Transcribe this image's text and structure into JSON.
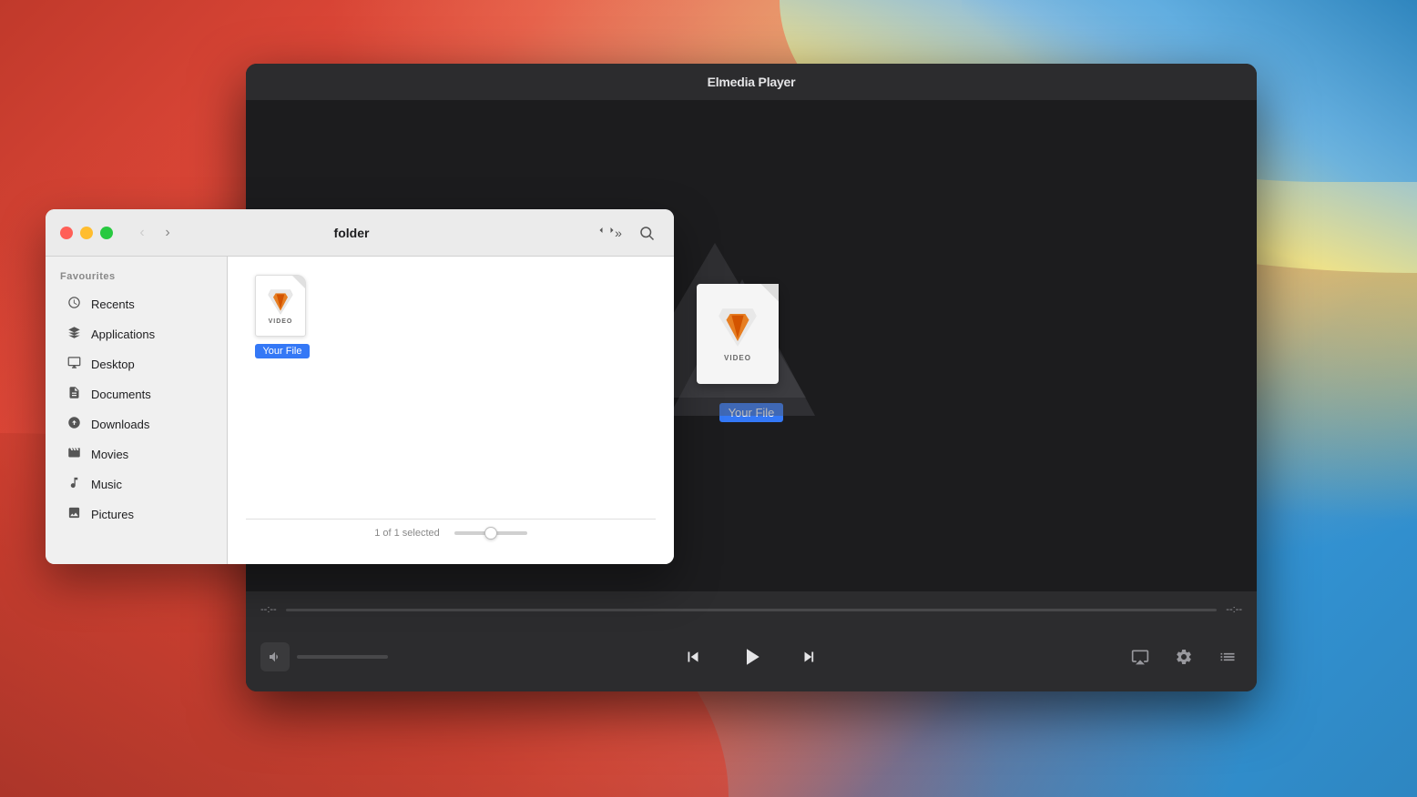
{
  "wallpaper": {
    "colors": {
      "redBase": "#c0392b",
      "blueAccent": "#3498db",
      "orangeAccent": "#e8a87c"
    }
  },
  "playerWindow": {
    "title": "Elmedia Player",
    "fileIcon": {
      "label": "VIDEO",
      "filename": "Your File"
    },
    "controls": {
      "timeStart": "--:--",
      "timeEnd": "--:--",
      "volumeButton": "🔈",
      "prevLabel": "⏮",
      "playLabel": "▶",
      "nextLabel": "⏭",
      "airplayLabel": "⊹",
      "settingsLabel": "⚙",
      "listLabel": "≡"
    }
  },
  "finderWindow": {
    "title": "folder",
    "sidebar": {
      "sectionLabel": "Favourites",
      "items": [
        {
          "id": "recents",
          "icon": "🕐",
          "label": "Recents"
        },
        {
          "id": "applications",
          "icon": "✦",
          "label": "Applications"
        },
        {
          "id": "desktop",
          "icon": "🖥",
          "label": "Desktop"
        },
        {
          "id": "documents",
          "icon": "📄",
          "label": "Documents"
        },
        {
          "id": "downloads",
          "icon": "⊙",
          "label": "Downloads"
        },
        {
          "id": "movies",
          "icon": "🎞",
          "label": "Movies"
        },
        {
          "id": "music",
          "icon": "♪",
          "label": "Music"
        },
        {
          "id": "pictures",
          "icon": "🖼",
          "label": "Pictures"
        }
      ]
    },
    "content": {
      "file": {
        "iconLabel": "VIDEO",
        "filename": "Your File"
      }
    },
    "statusbar": {
      "selectedText": "1 of 1 selected"
    },
    "toolbar": {
      "backLabel": "‹",
      "forwardLabel": "›",
      "chevronLabel": "»",
      "searchLabel": "⌕"
    }
  }
}
